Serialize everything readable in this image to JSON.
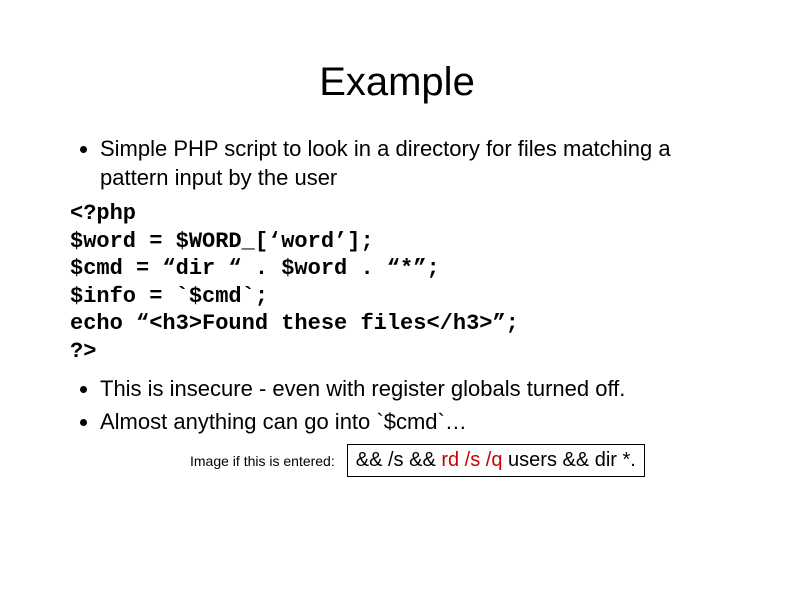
{
  "title": "Example",
  "bullet1": "Simple PHP script to look in a directory for files matching a pattern input by the user",
  "code": {
    "l1": "<?php",
    "l2": "$word = $WORD_[‘word’];",
    "l3": "$cmd = “dir “ . $word . “*”;",
    "l4": "$info = `$cmd`;",
    "l5": "echo “<h3>Found these files</h3>”;",
    "l6": "?>"
  },
  "bullet2": "This is insecure - even with register globals turned off.",
  "bullet3": "Almost anything can go into `$cmd`…",
  "bottom_label": "Image if this is entered:",
  "entered": {
    "part1": "&& /s && ",
    "red": "rd /s /q",
    "part2": " users && dir *."
  }
}
